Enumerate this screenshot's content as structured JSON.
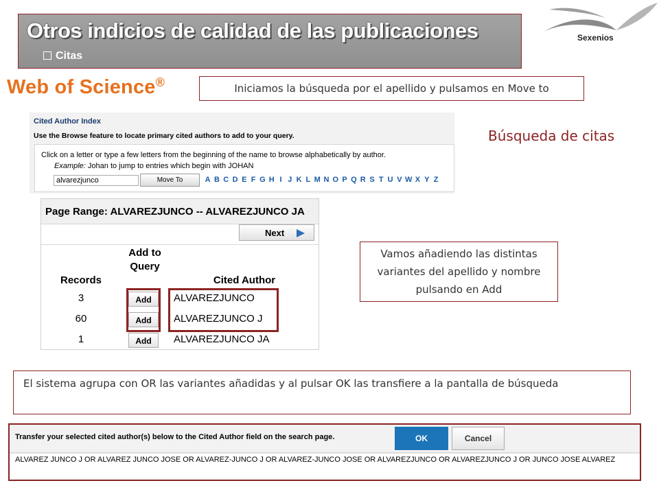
{
  "header": {
    "title": "Otros indicios de calidad de las publicaciones",
    "bullet": "Citas"
  },
  "logo": {
    "label": "Sexenios"
  },
  "wos_logo": {
    "text": "Web of Science",
    "mark": "®"
  },
  "callouts": {
    "search_hint": "Iniciamos la búsqueda por el apellido y pulsamos en Move to",
    "section_title": "Búsqueda de citas",
    "add_hint": "Vamos añadiendo las distintas variantes del apellido y nombre pulsando en Add",
    "or_hint": "El sistema agrupa con OR las variantes añadidas y al pulsar OK las transfiere a la pantalla de búsqueda"
  },
  "cited_author_index": {
    "title": "Cited Author Index",
    "subtitle": "Use the Browse feature to locate primary cited authors to add to your query.",
    "instructions": "Click on a letter or type a few letters from the beginning of the name to browse alphabetically by author.",
    "example_label": "Example:",
    "example_text": "Johan to jump to entries which begin with JOHAN",
    "input_value": "alvarezjunco",
    "move_to_label": "Move To",
    "letters": [
      "A",
      "B",
      "C",
      "D",
      "E",
      "F",
      "G",
      "H",
      "I",
      "J",
      "K",
      "L",
      "M",
      "N",
      "O",
      "P",
      "Q",
      "R",
      "S",
      "T",
      "U",
      "V",
      "W",
      "X",
      "Y",
      "Z"
    ]
  },
  "page_range": {
    "title": "Page Range: ALVAREZJUNCO -- ALVAREZJUNCO JA",
    "next_label": "Next",
    "columns": {
      "records": "Records",
      "add_to_query": "Add to Query",
      "cited_author": "Cited Author"
    },
    "rows": [
      {
        "records": "3",
        "add": "Add",
        "author": "ALVAREZJUNCO"
      },
      {
        "records": "60",
        "add": "Add",
        "author": "ALVAREZJUNCO J"
      },
      {
        "records": "1",
        "add": "Add",
        "author": "ALVAREZJUNCO JA"
      }
    ]
  },
  "transfer": {
    "message": "Transfer your selected cited author(s) below to the Cited Author field on the search page.",
    "ok_label": "OK",
    "cancel_label": "Cancel",
    "query": "ALVAREZ JUNCO J OR ALVAREZ JUNCO JOSE OR ALVAREZ-JUNCO J OR ALVAREZ-JUNCO JOSE OR ALVAREZJUNCO OR ALVAREZJUNCO J OR JUNCO JOSE ALVAREZ"
  },
  "colors": {
    "accent": "#8b2323",
    "wos_orange": "#e6711f",
    "link_blue": "#1a5aa6",
    "ok_blue": "#1c75b8"
  }
}
